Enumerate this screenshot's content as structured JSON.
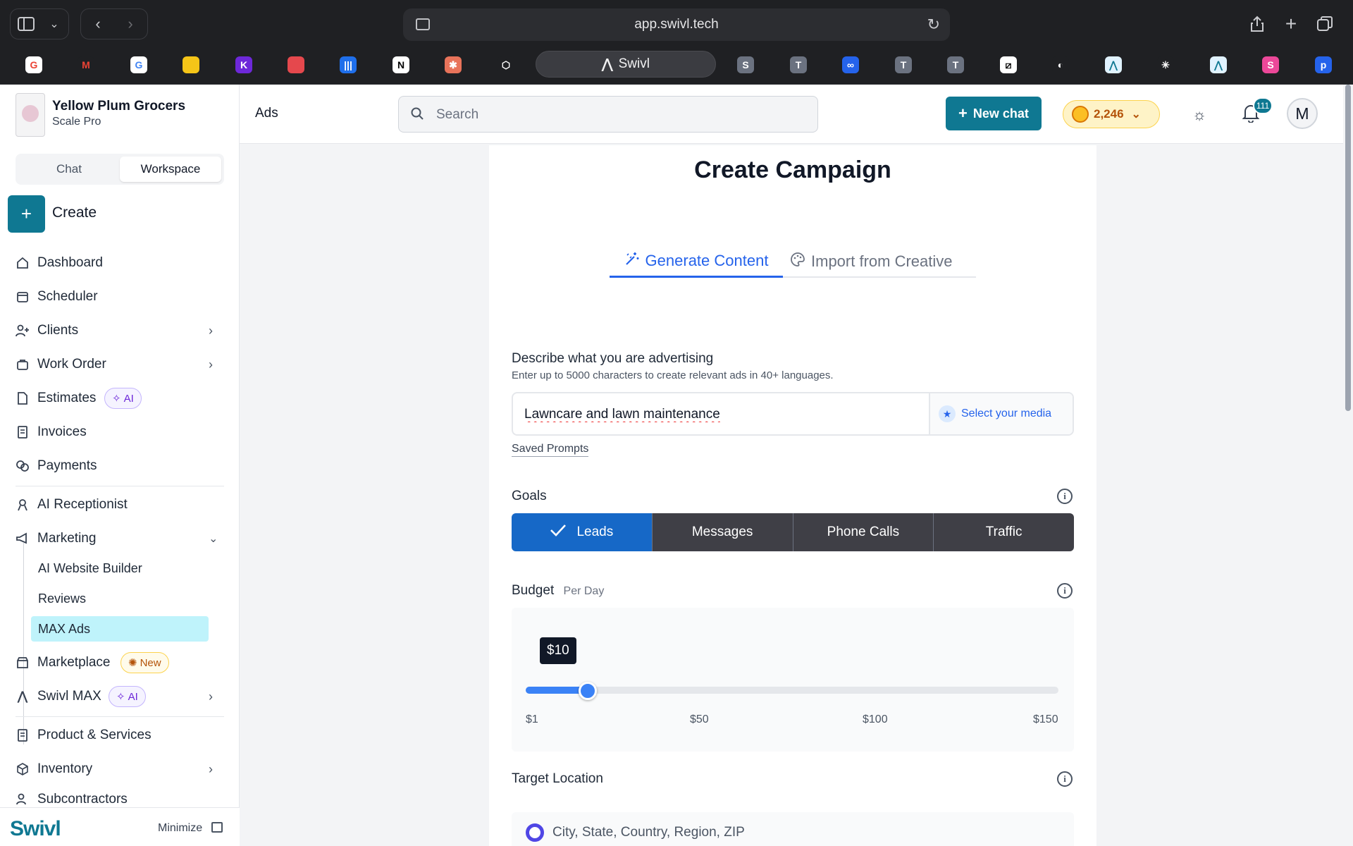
{
  "browser": {
    "url": "app.swivl.tech",
    "active_tab": "Swivl",
    "favicons": [
      {
        "name": "google-icon",
        "glyph": "G",
        "color": "#ffffff",
        "fg": "#ea4335"
      },
      {
        "name": "gmail-icon",
        "glyph": "M",
        "color": "#1f2023",
        "fg": "#ea4335"
      },
      {
        "name": "google-icon",
        "glyph": "G",
        "color": "#ffffff",
        "fg": "#4285f4"
      },
      {
        "name": "notes-icon",
        "glyph": "",
        "color": "#f5c518",
        "fg": "#000"
      },
      {
        "name": "k-icon",
        "glyph": "K",
        "color": "#6d28d9",
        "fg": "#fff"
      },
      {
        "name": "chart-icon",
        "glyph": "",
        "color": "#e5484d",
        "fg": "#fff"
      },
      {
        "name": "intercom-icon",
        "glyph": "|||",
        "color": "#1f6feb",
        "fg": "#fff"
      },
      {
        "name": "notion-icon",
        "glyph": "N",
        "color": "#ffffff",
        "fg": "#000"
      },
      {
        "name": "claude-icon",
        "glyph": "✱",
        "color": "#e8735a",
        "fg": "#fff"
      },
      {
        "name": "box-icon",
        "glyph": "⬡",
        "color": "#1f2023",
        "fg": "#fff"
      },
      {
        "name": "s-icon",
        "glyph": "S",
        "color": "#6b7280",
        "fg": "#fff"
      },
      {
        "name": "t-icon",
        "glyph": "T",
        "color": "#6b7280",
        "fg": "#fff"
      },
      {
        "name": "meta-icon",
        "glyph": "∞",
        "color": "#2563eb",
        "fg": "#fff"
      },
      {
        "name": "t-icon",
        "glyph": "T",
        "color": "#6b7280",
        "fg": "#fff"
      },
      {
        "name": "t-icon",
        "glyph": "T",
        "color": "#6b7280",
        "fg": "#fff"
      },
      {
        "name": "stripe-slash-icon",
        "glyph": "⧄",
        "color": "#ffffff",
        "fg": "#000"
      },
      {
        "name": "moon-icon",
        "glyph": "◐",
        "color": "#1f2023",
        "fg": "#fff"
      },
      {
        "name": "swivl-icon",
        "glyph": "⋀",
        "color": "#e0f2fe",
        "fg": "#0f7892"
      },
      {
        "name": "grid-icon",
        "glyph": "✳",
        "color": "#1f2023",
        "fg": "#fff"
      },
      {
        "name": "swivl-icon",
        "glyph": "⋀",
        "color": "#e0f2fe",
        "fg": "#0f7892"
      },
      {
        "name": "s-pink-icon",
        "glyph": "S",
        "color": "#ec4899",
        "fg": "#fff"
      },
      {
        "name": "plai-icon",
        "glyph": "p",
        "color": "#2563eb",
        "fg": "#fff"
      }
    ]
  },
  "workspace": {
    "name": "Yellow Plum Grocers",
    "plan": "Scale Pro"
  },
  "mode_switch": {
    "chat": "Chat",
    "workspace": "Workspace",
    "selected": "Workspace"
  },
  "create_label": "Create",
  "nav": {
    "dashboard": "Dashboard",
    "scheduler": "Scheduler",
    "clients": "Clients",
    "work_order": "Work Order",
    "estimates": "Estimates",
    "estimates_badge": "AI",
    "invoices": "Invoices",
    "payments": "Payments",
    "ai_receptionist": "AI Receptionist",
    "marketing": "Marketing",
    "marketing_sub": [
      "AI Website Builder",
      "Reviews",
      "MAX Ads"
    ],
    "marketplace": "Marketplace",
    "marketplace_badge": "New",
    "swivl_max": "Swivl MAX",
    "swivl_max_badge": "AI",
    "products": "Product & Services",
    "inventory": "Inventory",
    "subcontractors": "Subcontractors"
  },
  "footer": {
    "logo": "Swivl",
    "minimize": "Minimize"
  },
  "topbar": {
    "page": "Ads",
    "search_placeholder": "Search",
    "new_chat": "New chat",
    "credits": "2,246",
    "notifications": "111",
    "avatar": "M"
  },
  "campaign": {
    "title": "Create Campaign",
    "tab_generate": "Generate Content",
    "tab_import": "Import from Creative",
    "describe_label": "Describe what you are advertising",
    "describe_help": "Enter up to 5000 characters to create relevant ads in 40+ languages.",
    "prompt_value": "Lawncare and lawn maintenance",
    "select_media": "Select your media",
    "saved_prompts": "Saved Prompts",
    "goals_label": "Goals",
    "goals": [
      "Leads",
      "Messages",
      "Phone Calls",
      "Traffic"
    ],
    "goal_selected": "Leads",
    "budget_label": "Budget",
    "budget_unit": "Per Day",
    "budget_value": "$10",
    "budget_amount": 10,
    "budget_min": 1,
    "budget_max": 150,
    "budget_ticks": [
      "$1",
      "$50",
      "$100",
      "$150"
    ],
    "location_label": "Target Location",
    "location_option": "City, State, Country, Region, ZIP"
  },
  "colors": {
    "brand": "#0f7892",
    "accent": "#2563eb",
    "selected_goal": "#1668c7"
  }
}
